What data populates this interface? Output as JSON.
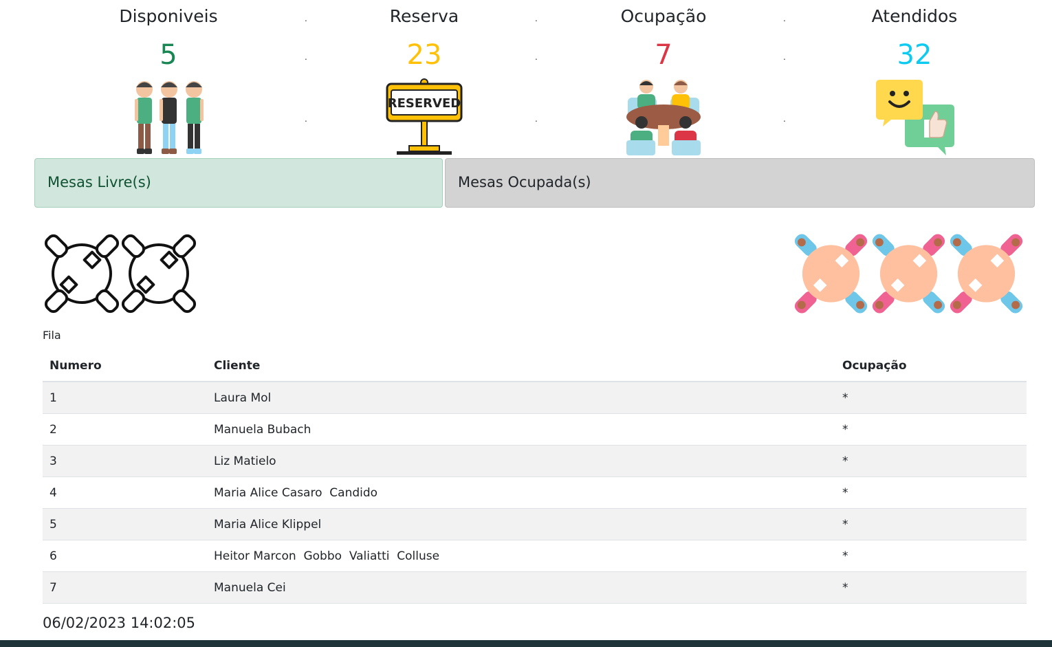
{
  "stats": {
    "available": {
      "title": "Disponiveis",
      "value": "5",
      "color": "#198754",
      "icon": "people-standing-icon"
    },
    "reserved": {
      "title": "Reserva",
      "value": "23",
      "color": "#ffc107",
      "icon": "reserved-sign-icon",
      "sign_text": "RESERVED"
    },
    "occupancy": {
      "title": "Ocupação",
      "value": "7",
      "color": "#dc3545",
      "icon": "people-at-table-icon"
    },
    "served": {
      "title": "Atendidos",
      "value": "32",
      "color": "#0dcaf0",
      "icon": "feedback-chat-icon"
    }
  },
  "panels": {
    "free_tables": "Mesas Livre(s)",
    "occupied_tables": "Mesas Ocupada(s)"
  },
  "queue": {
    "label": "Fila",
    "columns": [
      "Numero",
      "Cliente",
      "Ocupação"
    ],
    "rows": [
      {
        "number": "1",
        "client": "Laura Mol",
        "occupancy": "*"
      },
      {
        "number": "2",
        "client": "Manuela Bubach",
        "occupancy": "*"
      },
      {
        "number": "3",
        "client": "Liz Matielo",
        "occupancy": "*"
      },
      {
        "number": "4",
        "client": "Maria Alice Casaro  Candido",
        "occupancy": "*"
      },
      {
        "number": "5",
        "client": "Maria Alice Klippel",
        "occupancy": "*"
      },
      {
        "number": "6",
        "client": "Heitor Marcon  Gobbo  Valiatti  Colluse",
        "occupancy": "*"
      },
      {
        "number": "7",
        "client": "Manuela Cei",
        "occupancy": "*"
      }
    ]
  },
  "timestamp": "06/02/2023 14:02:05"
}
